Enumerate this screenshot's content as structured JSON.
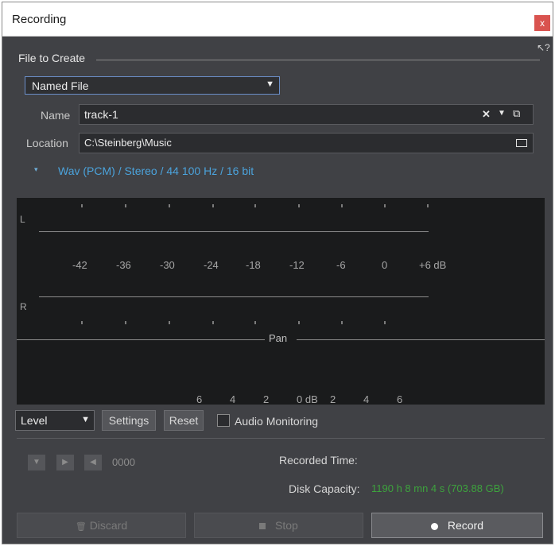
{
  "window": {
    "title": "Recording",
    "close_glyph": "x"
  },
  "help": {
    "glyph": "↖?"
  },
  "file_group": {
    "label": "File to Create",
    "mode": "Named File",
    "name_label": "Name",
    "name_value": "track-1",
    "location_label": "Location",
    "location_value": "C:\\Steinberg\\Music",
    "format": "Wav (PCM) / Stereo / 44 100 Hz / 16 bit"
  },
  "meter": {
    "left_channel": "L",
    "right_channel": "R",
    "db_scale": [
      "-42",
      "-36",
      "-30",
      "-24",
      "-18",
      "-12",
      "-6",
      "0",
      "+6 dB"
    ],
    "pan_label": "Pan",
    "pan_scale": [
      "6",
      "4",
      "2",
      "0 dB",
      "2",
      "4",
      "6"
    ]
  },
  "controls": {
    "view_mode": "Level",
    "settings_label": "Settings",
    "reset_label": "Reset",
    "monitoring_label": "Audio Monitoring"
  },
  "transport": {
    "counter": "0000"
  },
  "info": {
    "recorded_time_label": "Recorded Time:",
    "disk_capacity_label": "Disk Capacity:",
    "disk_capacity_value": "1190 h 8 mn 4 s (703.88 GB)"
  },
  "actions": {
    "discard": "Discard",
    "stop": "Stop",
    "record": "Record"
  },
  "colors": {
    "accent_blue": "#4ba3dc",
    "disk_green": "#3da33d",
    "close_red": "#d9534f"
  }
}
